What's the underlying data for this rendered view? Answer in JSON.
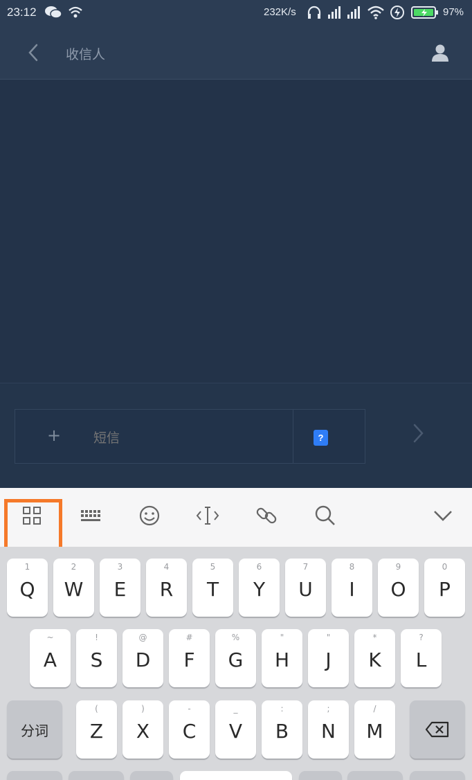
{
  "status_bar": {
    "time": "23:12",
    "net_speed": "232K/s",
    "battery": "97%",
    "icons": [
      "wechat-icon",
      "wifi-small-icon",
      "headphones-icon",
      "signal-icon",
      "signal-icon",
      "wifi-icon",
      "charging-icon",
      "battery-icon"
    ]
  },
  "header": {
    "title": "收信人"
  },
  "composer": {
    "placeholder": "短信",
    "plus_label": "+",
    "sim_label": "?"
  },
  "toolbar": {
    "icons": [
      "grid-icon",
      "keyboard-icon",
      "emoji-icon",
      "cursor-icon",
      "link-icon",
      "search-icon",
      "chevron-down-icon"
    ]
  },
  "keyboard": {
    "row1": [
      {
        "char": "Q",
        "hint": "1"
      },
      {
        "char": "W",
        "hint": "2"
      },
      {
        "char": "E",
        "hint": "3"
      },
      {
        "char": "R",
        "hint": "4"
      },
      {
        "char": "T",
        "hint": "5"
      },
      {
        "char": "Y",
        "hint": "6"
      },
      {
        "char": "U",
        "hint": "7"
      },
      {
        "char": "I",
        "hint": "8"
      },
      {
        "char": "O",
        "hint": "9"
      },
      {
        "char": "P",
        "hint": "0"
      }
    ],
    "row2": [
      {
        "char": "A",
        "hint": "~"
      },
      {
        "char": "S",
        "hint": "!"
      },
      {
        "char": "D",
        "hint": "@"
      },
      {
        "char": "F",
        "hint": "#"
      },
      {
        "char": "G",
        "hint": "%"
      },
      {
        "char": "H",
        "hint": "\""
      },
      {
        "char": "J",
        "hint": "\""
      },
      {
        "char": "K",
        "hint": "*"
      },
      {
        "char": "L",
        "hint": "?"
      }
    ],
    "row3": [
      {
        "char": "Z",
        "hint": "("
      },
      {
        "char": "X",
        "hint": ")"
      },
      {
        "char": "C",
        "hint": "-"
      },
      {
        "char": "V",
        "hint": "_"
      },
      {
        "char": "B",
        "hint": ":"
      },
      {
        "char": "N",
        "hint": ";"
      },
      {
        "char": "M",
        "hint": "/"
      }
    ],
    "segment_label": "分词"
  }
}
